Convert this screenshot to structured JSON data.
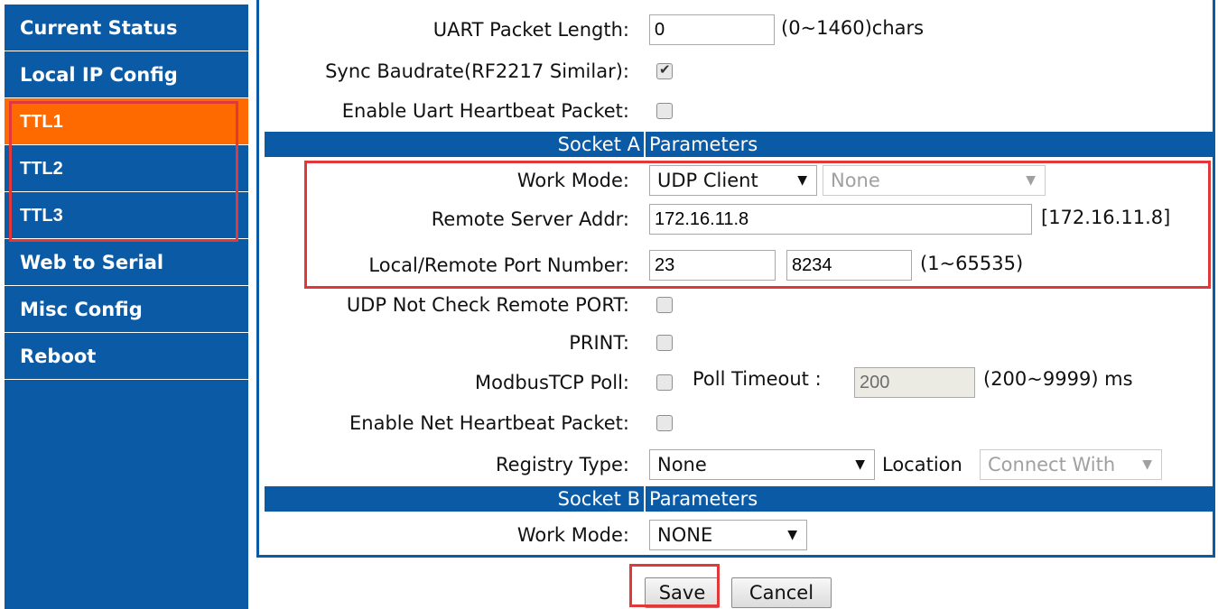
{
  "sidebar": {
    "items": [
      {
        "label": "Current Status",
        "active": false
      },
      {
        "label": "Local IP Config",
        "active": false
      },
      {
        "label": "TTL1",
        "active": true
      },
      {
        "label": "TTL2",
        "active": false
      },
      {
        "label": "TTL3",
        "active": false
      },
      {
        "label": "Web to Serial",
        "active": false
      },
      {
        "label": "Misc Config",
        "active": false
      },
      {
        "label": "Reboot",
        "active": false
      }
    ]
  },
  "form": {
    "uart_packet_length": {
      "label": "UART Packet Length:",
      "value": "0",
      "note": "(0~1460)chars"
    },
    "sync_baudrate": {
      "label": "Sync Baudrate(RF2217 Similar):",
      "checked": true
    },
    "uart_heartbeat": {
      "label": "Enable Uart Heartbeat Packet:",
      "checked": false
    },
    "socket_a": {
      "title_left": "Socket A",
      "title_right": "Parameters",
      "work_mode": {
        "label": "Work Mode:",
        "value": "UDP Client",
        "secondary_value": "None"
      },
      "remote_server": {
        "label": "Remote Server Addr:",
        "value": "172.16.11.8",
        "note": "[172.16.11.8]"
      },
      "port_number": {
        "label": "Local/Remote Port Number:",
        "local": "23",
        "remote": "8234",
        "note": "(1~65535)"
      }
    },
    "udp_not_check": {
      "label": "UDP Not Check Remote PORT:",
      "checked": false
    },
    "print": {
      "label": "PRINT:",
      "checked": false
    },
    "modbus_poll": {
      "label": "ModbusTCP Poll:",
      "checked": false,
      "timeout_label": "Poll Timeout :",
      "timeout_value": "200",
      "timeout_note": "(200~9999) ms"
    },
    "net_heartbeat": {
      "label": "Enable Net Heartbeat Packet:",
      "checked": false
    },
    "registry": {
      "label": "Registry Type:",
      "value": "None",
      "location_label": "Location",
      "location_value": "Connect With"
    },
    "socket_b": {
      "title_left": "Socket B",
      "title_right": "Parameters",
      "work_mode": {
        "label": "Work Mode:",
        "value": "NONE"
      }
    }
  },
  "buttons": {
    "save": "Save",
    "cancel": "Cancel"
  },
  "colors": {
    "sidebar_bg": "#0b5aa6",
    "active_item": "#ff6a00",
    "highlight": "#e0383b"
  },
  "icons": {
    "select_arrow": "triangle-down-icon",
    "check": "checkmark-icon"
  }
}
